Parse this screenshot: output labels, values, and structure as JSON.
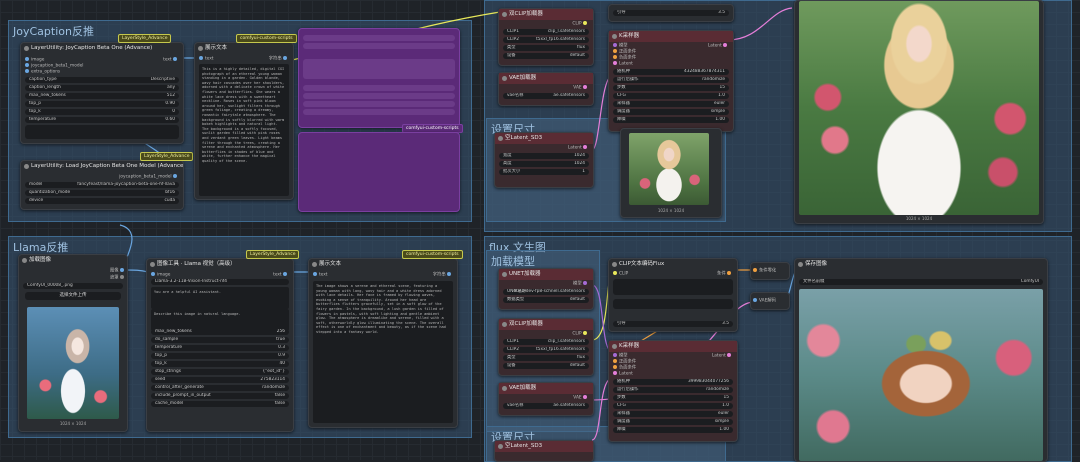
{
  "groups": {
    "joycaption": "JoyCaption反推",
    "llama": "Llama反推",
    "flux_top": "设置尺寸",
    "flux_main": "flux 文生图",
    "flux_sub": "加载模型",
    "size_bottom": "设置尺寸"
  },
  "joy_node": {
    "badge": "LayerStyle_Advance",
    "title": "LayerUtility: JoyCaption Beta One (Advance)",
    "inputs": [
      "image",
      "joycaption_beta1_model",
      "extra_options"
    ],
    "output_label": "text",
    "rows": [
      {
        "k": "caption_type",
        "v": "Descriptive"
      },
      {
        "k": "caption_length",
        "v": "any"
      },
      {
        "k": "max_new_tokens",
        "v": "512"
      },
      {
        "k": "top_p",
        "v": "0.90"
      },
      {
        "k": "top_k",
        "v": "0"
      },
      {
        "k": "temperature",
        "v": "0.60"
      }
    ]
  },
  "joy_load": {
    "badge": "LayerStyle_Advance",
    "title": "LayerUtility: Load JoyCaption Beta One Model (Advance)",
    "output": "joycaption_beta1_model",
    "rows": [
      {
        "k": "model",
        "v": "fancyfeast/llama-joycaption-beta-one-hf-llava"
      },
      {
        "k": "quantization_mode",
        "v": "bf16"
      },
      {
        "k": "device",
        "v": "cuda"
      }
    ]
  },
  "show_text_1": {
    "badge": "comfyui-custom-scripts",
    "title": "展示文本",
    "input": "text",
    "output": "字符串",
    "text": "This is a highly detailed, digital CGI photograph of an ethereal young woman standing in a garden. Golden blonde, wavy hair cascades over her shoulders, adorned with a delicate crown of white flowers and butterflies. She wears a white lace dress with a sweetheart neckline. Roses in soft pink bloom around her, sunlight filters through green foliage, creating a dreamy, romantic fairytale atmosphere. The background is softly blurred with warm bokeh highlights and natural light.\n\nThe background is a softly focused, sunlit garden filled with pink roses and verdant green leaves. Light beams filter through the trees, creating a serene and enchanted atmosphere. Her butterflies in shades of blue and white, further enhance the magical quality of the scene."
  },
  "purple_node": {
    "badge": "comfyui-custom-scripts"
  },
  "llama_load": {
    "title": "加载图像",
    "file": "ComfyUI_00008_.png",
    "upload": "选择文件上传",
    "caption": "1024 × 1024",
    "outputs": [
      "图像",
      "遮罩"
    ]
  },
  "llama_node": {
    "badge": "LayerStyle_Advance",
    "title": "图像工具 · Llama 视觉（高级）",
    "input": "image",
    "output": "text",
    "model": "Llama-3.2-11B-Vision-Instruct-nf4",
    "system_prompt": "You are a helpful AI assistant.",
    "user_prompt": "Describe this image in natural language.",
    "rows": [
      {
        "k": "max_new_tokens",
        "v": "256"
      },
      {
        "k": "do_sample",
        "v": "true"
      },
      {
        "k": "temperature",
        "v": "0.3"
      },
      {
        "k": "top_p",
        "v": "0.9"
      },
      {
        "k": "top_k",
        "v": "40"
      },
      {
        "k": "stop_strings",
        "v": "{\"eot_id\"}"
      },
      {
        "k": "seed",
        "v": "275823114"
      },
      {
        "k": "control_after_generate",
        "v": "randomize"
      },
      {
        "k": "include_prompt_in_output",
        "v": "false"
      },
      {
        "k": "cache_model",
        "v": "false"
      }
    ]
  },
  "show_text_2": {
    "badge": "comfyui-custom-scripts",
    "title": "展示文本",
    "input": "text",
    "output": "字符串",
    "text": "The image shows a serene and ethereal scene, featuring a young woman with long, wavy hair and a white dress adorned with lace details. Her face is framed by flowing waves, evoking a sense of tranquility. Around her head are butterflies flutters gracefully, set in a soft glow of the fairy garden.\n\nIn the background, a lush garden is filled of flowers in pastels, with soft lighting and gentle ambient glow. The atmosphere is dreamlike and serene, filled with a soft, otherworldly glow illuminating the scene. The overall effect is one of enchantment and beauty, as if the scene had stepped into a fantasy world."
  },
  "top_nodes": {
    "clip_top": {
      "title": "双CLIP加载器",
      "rows": [
        {
          "k": "CLIP1",
          "v": "clip_l.safetensors"
        },
        {
          "k": "CLIP2",
          "v": "t5xxl_fp16.safetensors"
        },
        {
          "k": "类型",
          "v": "flux"
        },
        {
          "k": "设备",
          "v": "default"
        }
      ],
      "out": "CLIP"
    },
    "vae_top": {
      "title": "VAE加载器",
      "row": {
        "k": "vae名称",
        "v": "ae.safetensors"
      },
      "out": "VAE"
    },
    "guide_top": {
      "k": "引导",
      "v": "3.5"
    },
    "ksampler_top": {
      "title": "K采样器",
      "inputs": [
        "模型",
        "正面条件",
        "负面条件",
        "Latent"
      ],
      "out": "Latent",
      "rows": [
        {
          "k": "随机种",
          "v": "432488367874311"
        },
        {
          "k": "运行后操作",
          "v": "randomize"
        },
        {
          "k": "步数",
          "v": "15"
        },
        {
          "k": "CFG",
          "v": "1.0"
        },
        {
          "k": "采样器",
          "v": "euler"
        },
        {
          "k": "调度器",
          "v": "simple"
        },
        {
          "k": "降噪",
          "v": "1.00"
        }
      ]
    },
    "latent_top": {
      "title": "空Latent_SD3",
      "out": "Latent",
      "rows": [
        {
          "k": "宽度",
          "v": "1024"
        },
        {
          "k": "高度",
          "v": "1024"
        },
        {
          "k": "批次大小",
          "v": "1"
        }
      ]
    },
    "preview_caption": "1024 × 1024",
    "big_caption": "1024 × 1024"
  },
  "bottom_nodes": {
    "unet": {
      "title": "UNET加载器",
      "out": "模型",
      "rows": [
        {
          "k": "UNet名称",
          "v": "flux1-dev-fp8-schnell.safetensors"
        },
        {
          "k": "数据类型",
          "v": "default"
        }
      ]
    },
    "clip": {
      "title": "双CLIP加载器",
      "out": "CLIP",
      "rows": [
        {
          "k": "CLIP1",
          "v": "clip_l.safetensors"
        },
        {
          "k": "CLIP2",
          "v": "t5xxl_fp16.safetensors"
        },
        {
          "k": "类型",
          "v": "flux"
        },
        {
          "k": "设备",
          "v": "default"
        }
      ]
    },
    "vae": {
      "title": "VAE加载器",
      "out": "VAE",
      "row": {
        "k": "vae名称",
        "v": "ae.safetensors"
      }
    },
    "clip_text": {
      "title": "CLIP文本编码Flux",
      "in": "CLIP",
      "out": "条件",
      "guide": {
        "k": "引导",
        "v": "3.5"
      }
    },
    "ksampler": {
      "title": "K采样器",
      "out": "Latent",
      "inputs": [
        "模型",
        "正面条件",
        "负面条件",
        "Latent"
      ],
      "rows": [
        {
          "k": "随机种",
          "v": "399983044077256"
        },
        {
          "k": "运行后操作",
          "v": "randomize"
        },
        {
          "k": "步数",
          "v": "15"
        },
        {
          "k": "CFG",
          "v": "1.0"
        },
        {
          "k": "采样器",
          "v": "euler"
        },
        {
          "k": "调度器",
          "v": "simple"
        },
        {
          "k": "降噪",
          "v": "1.00"
        }
      ]
    },
    "cond_zero": {
      "title": "条件零化",
      "in": "条件",
      "out": "条件"
    },
    "vae_decode": {
      "title": "VAE解码",
      "inputs": [
        "Latent",
        "vae"
      ],
      "out": "图像"
    },
    "save": {
      "title": "保存图像",
      "prefix_k": "文件名前缀",
      "prefix_v": "ComfyUI"
    },
    "latent": {
      "title": "空Latent_SD3"
    }
  },
  "colors": {
    "accent_wire": "#e8e85a",
    "wire_pink": "#e47ed8",
    "wire_purple": "#a66bd6",
    "wire_blue": "#6aa6e0",
    "wire_orange": "#f0a040"
  }
}
